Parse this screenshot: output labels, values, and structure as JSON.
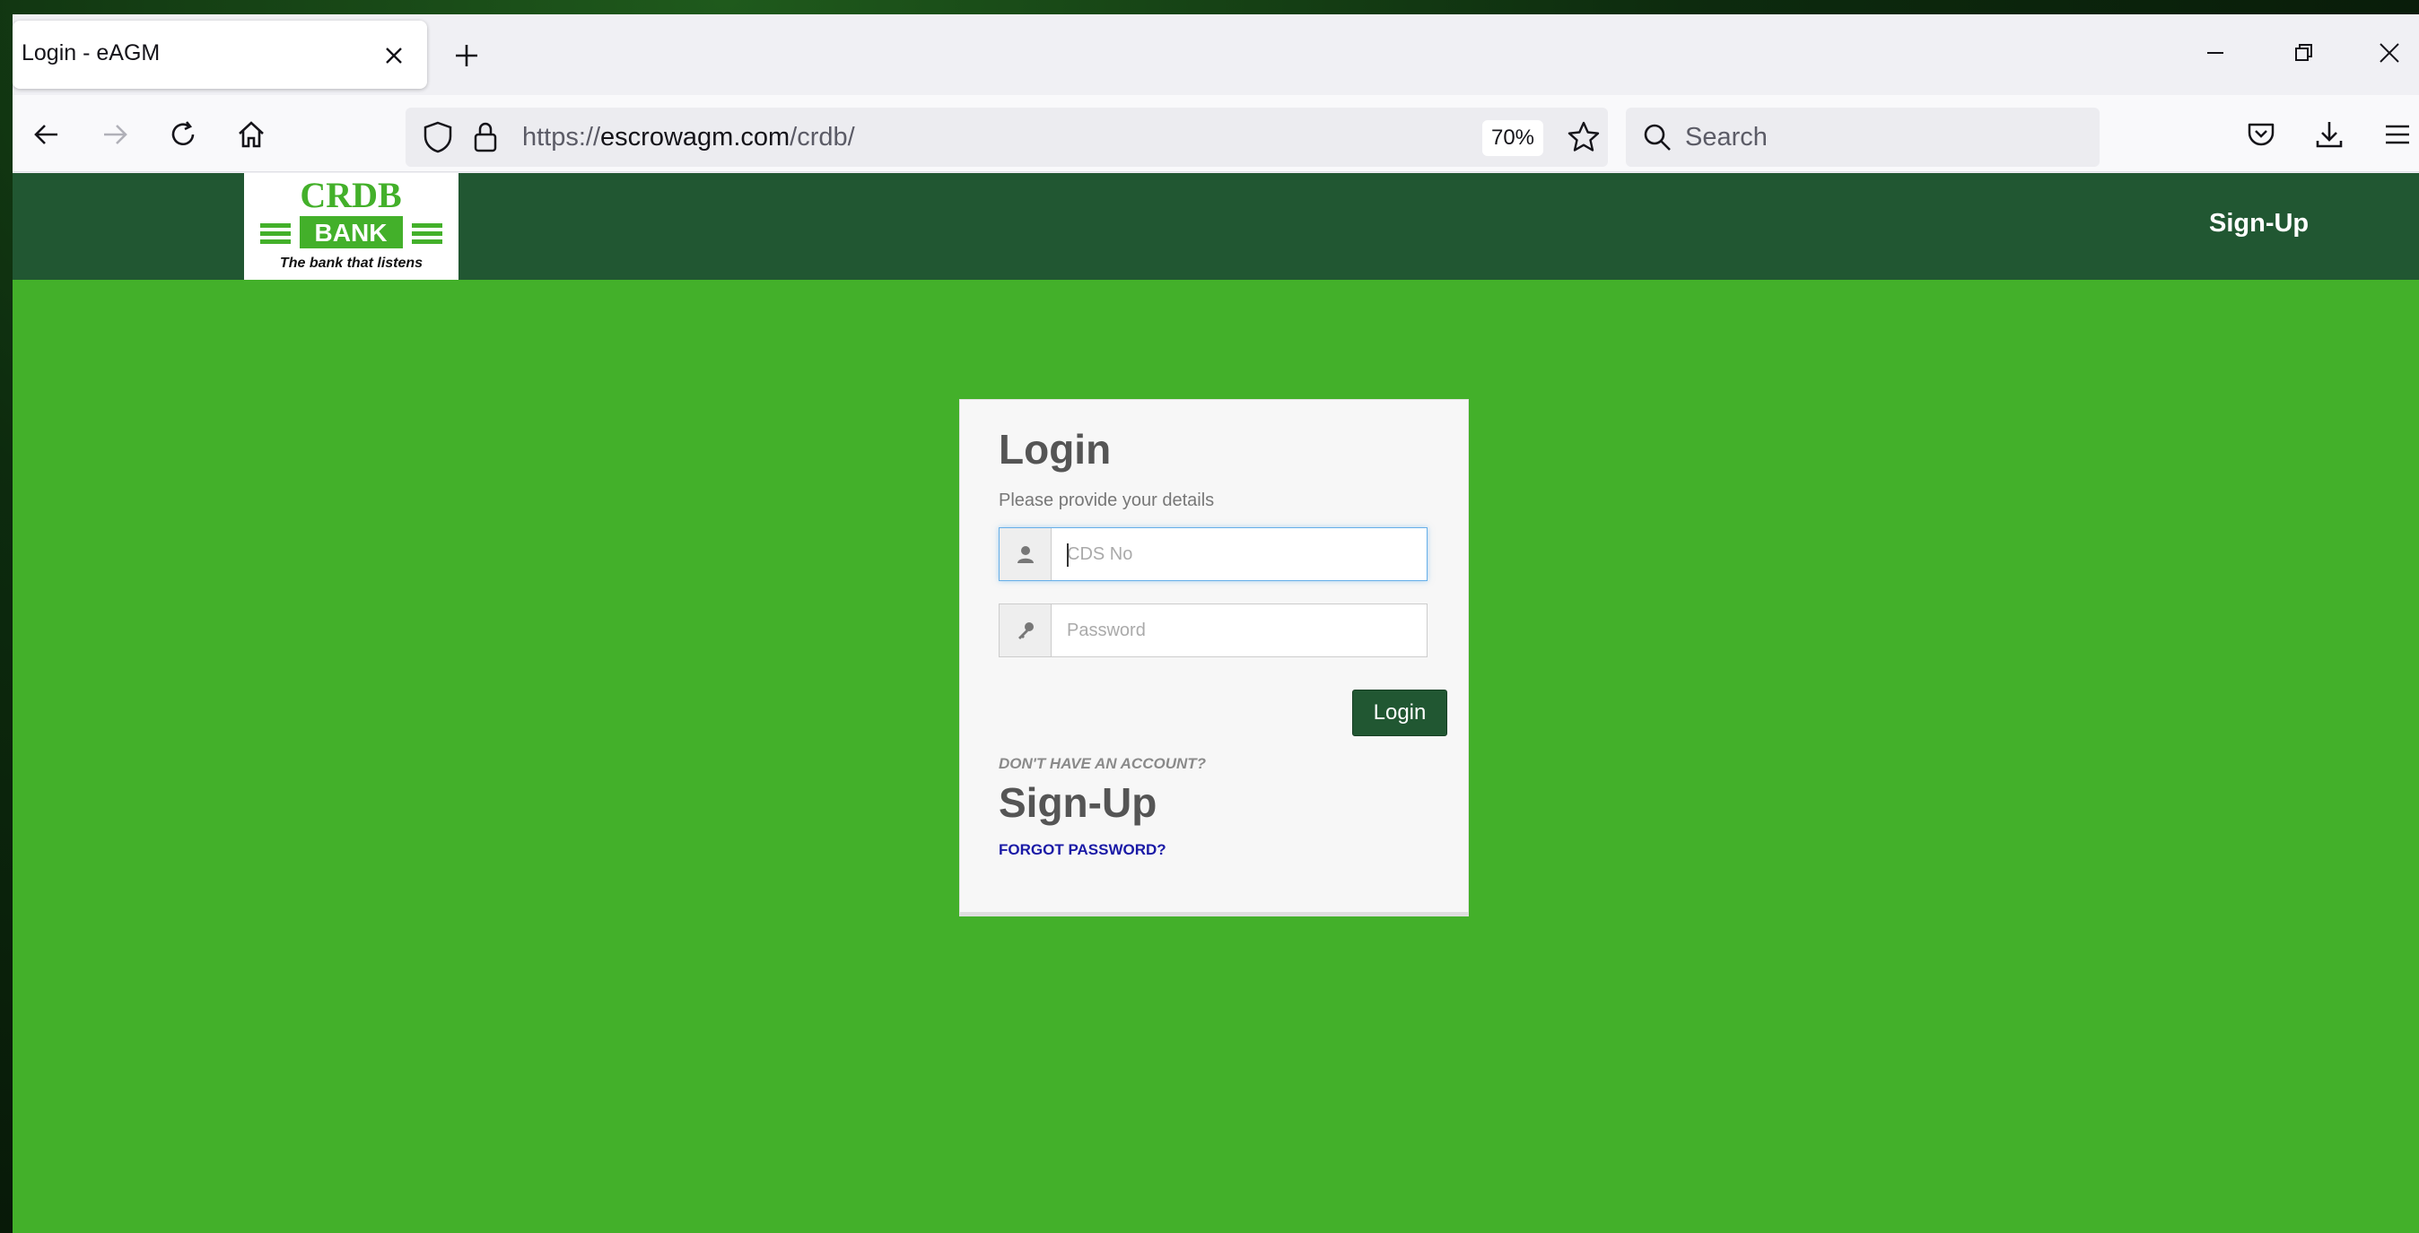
{
  "browser": {
    "tab_title": "Login - eAGM",
    "url_scheme": "https://",
    "url_host": "escrowagm.com",
    "url_path": "/crdb/",
    "zoom": "70%",
    "search_placeholder": "Search"
  },
  "site": {
    "logo_text": "CRDB BANK",
    "logo_tagline": "The bank that listens",
    "header_signup": "Sign-Up",
    "brand_colors": {
      "header": "#215732",
      "background": "#43b02a"
    }
  },
  "login": {
    "title": "Login",
    "subtitle": "Please provide your details",
    "cds_placeholder": "CDS No",
    "password_placeholder": "Password",
    "button": "Login",
    "no_account": "DON'T HAVE AN ACCOUNT?",
    "signup": "Sign-Up",
    "forgot": "FORGOT PASSWORD?"
  }
}
